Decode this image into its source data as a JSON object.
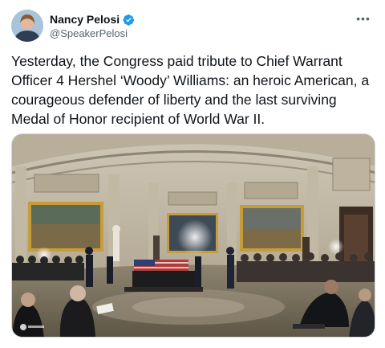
{
  "author": {
    "name": "Nancy Pelosi",
    "handle": "@SpeakerPelosi",
    "avatar_icon": "profile-photo",
    "verified_icon": "verified-badge-icon",
    "verified_color": "#1d9bf0"
  },
  "tweet": {
    "text": "Yesterday, the Congress paid tribute to Chief Warrant Officer 4 Hershel ‘Woody’ Williams: an heroic American, a courageous defender of liberty and the last surviving Medal of Honor recipient of World War II."
  },
  "menu": {
    "more_label": "•••"
  },
  "photo": {
    "description_icon": "capitol-rotunda-ceremony-photo"
  }
}
